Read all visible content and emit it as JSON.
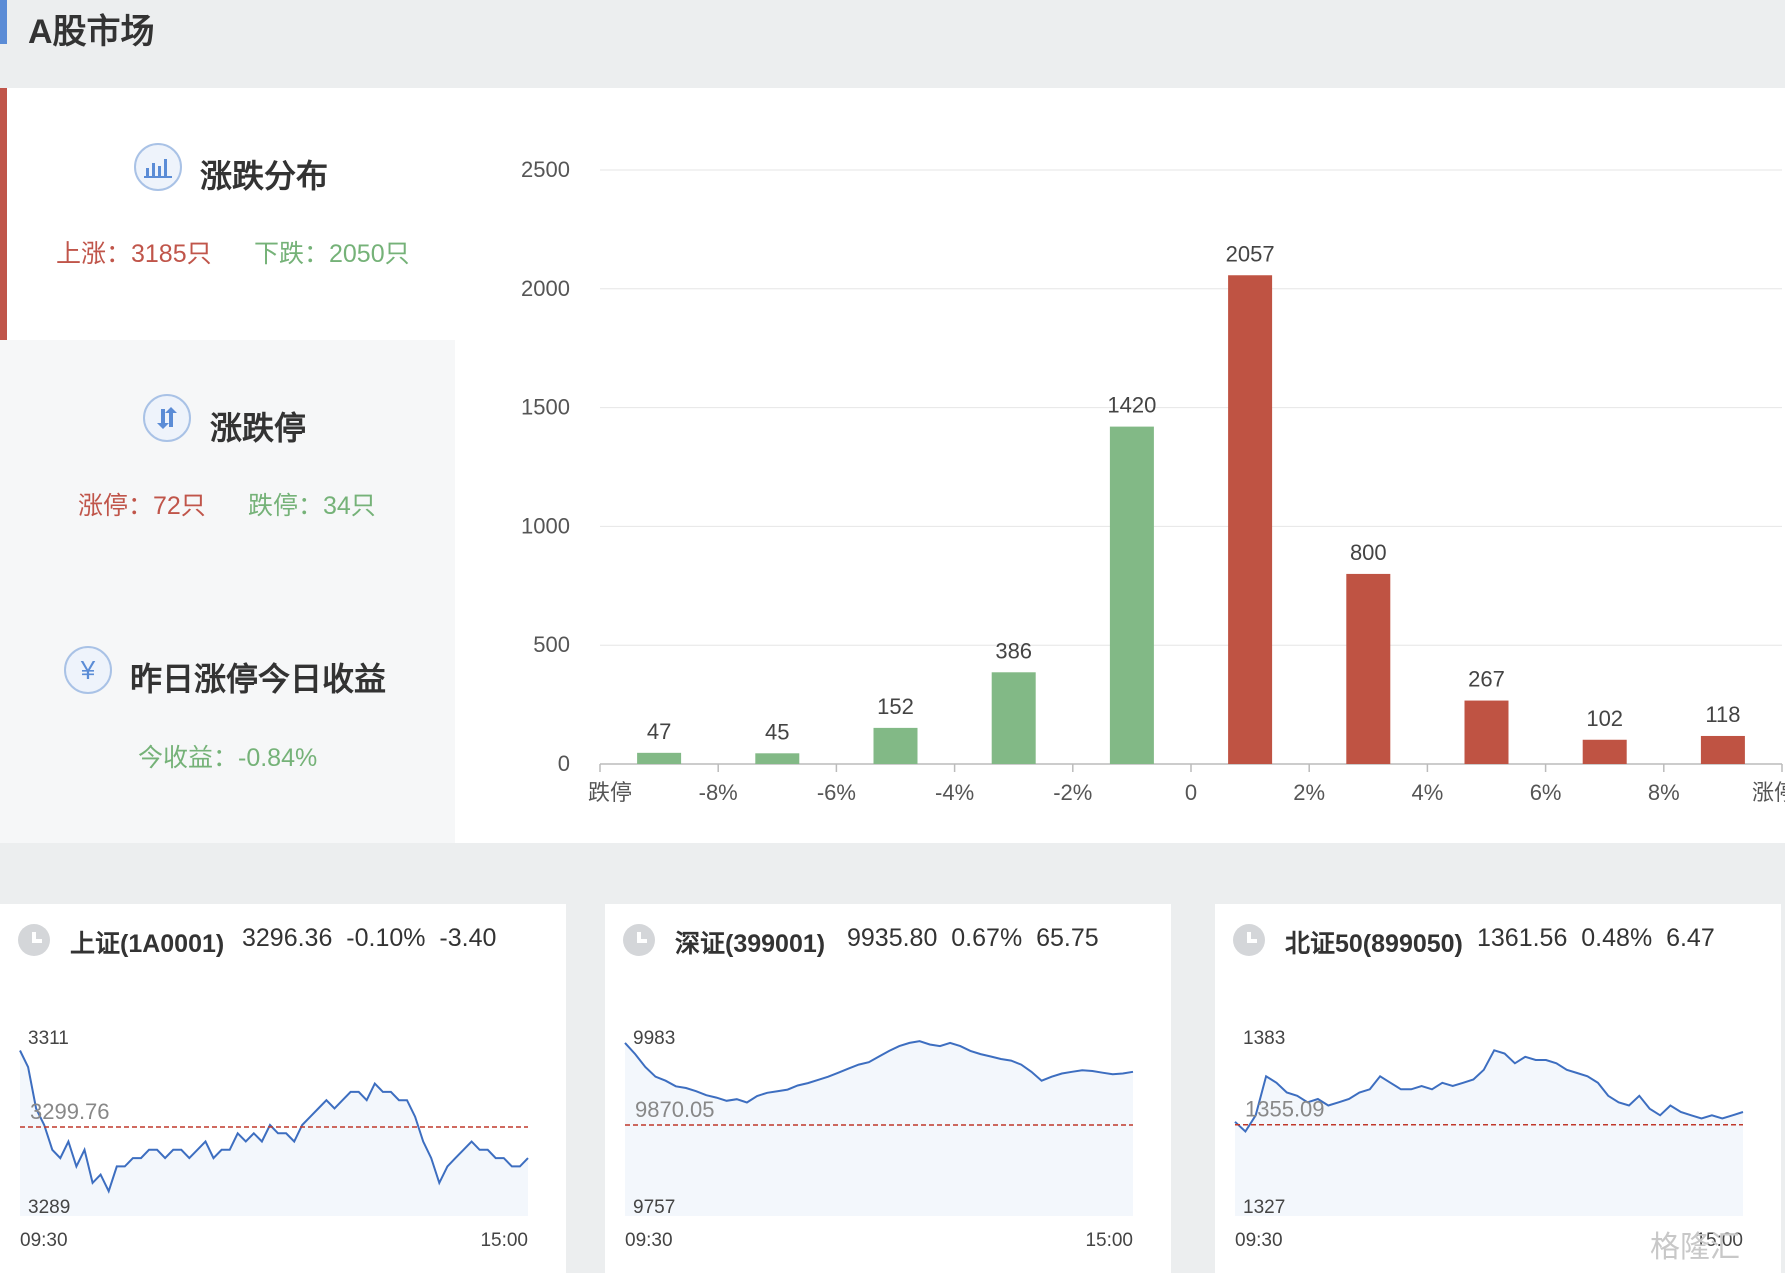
{
  "header": {
    "title": "A股市场"
  },
  "distribution": {
    "title": "涨跌分布",
    "up_label": "上涨：3185只",
    "down_label": "下跌：2050只"
  },
  "limits": {
    "title": "涨跌停",
    "up_label": "涨停：72只",
    "down_label": "跌停：34只"
  },
  "yesterday": {
    "title": "昨日涨停今日收益",
    "return_label": "今收益：-0.84%",
    "icon_glyph": "¥"
  },
  "chart_data": {
    "type": "bar",
    "categories": [
      "跌停",
      "-8%",
      "-6%",
      "-4%",
      "-2%",
      "0",
      "2%",
      "4%",
      "6%",
      "8%",
      "涨停"
    ],
    "bars": [
      {
        "value": 47,
        "color": "#82b986"
      },
      {
        "value": 45,
        "color": "#82b986"
      },
      {
        "value": 152,
        "color": "#82b986"
      },
      {
        "value": 386,
        "color": "#82b986"
      },
      {
        "value": 1420,
        "color": "#82b986"
      },
      {
        "value": 2057,
        "color": "#bf5343"
      },
      {
        "value": 800,
        "color": "#bf5343"
      },
      {
        "value": 267,
        "color": "#bf5343"
      },
      {
        "value": 102,
        "color": "#bf5343"
      },
      {
        "value": 118,
        "color": "#bf5343"
      }
    ],
    "ylim": [
      0,
      2500
    ],
    "yticks": [
      0,
      500,
      1000,
      1500,
      2000,
      2500
    ],
    "grid": true
  },
  "indices": [
    {
      "name": "上证(1A0001)",
      "value": "3296.36",
      "pct": "-0.10%",
      "change": "-3.40",
      "y_max_label": "3311",
      "y_ref_label": "3299.76",
      "y_min_label": "3289",
      "x_start_label": "09:30",
      "x_end_label": "15:00",
      "y_max": 3311,
      "y_min": 3289,
      "y_ref": 3299.76,
      "series": [
        3309,
        3307,
        3302,
        3300,
        3297,
        3296,
        3298,
        3295,
        3297,
        3293,
        3294,
        3292,
        3295,
        3295,
        3296,
        3296,
        3297,
        3297,
        3296,
        3297,
        3297,
        3296,
        3297,
        3298,
        3296,
        3297,
        3297,
        3299,
        3298,
        3299,
        3298,
        3300,
        3299,
        3299,
        3298,
        3300,
        3301,
        3302,
        3303,
        3302,
        3303,
        3304,
        3304,
        3303,
        3305,
        3304,
        3304,
        3303,
        3303,
        3301,
        3298,
        3296,
        3293,
        3295,
        3296,
        3297,
        3298,
        3297,
        3297,
        3296,
        3296,
        3295,
        3295,
        3296
      ]
    },
    {
      "name": "深证(399001)",
      "value": "9935.80",
      "pct": "0.67%",
      "change": "65.75",
      "y_max_label": "9983",
      "y_ref_label": "9870.05",
      "y_min_label": "9757",
      "x_start_label": "09:30",
      "x_end_label": "15:00",
      "y_max": 9983,
      "y_min": 9757,
      "y_ref": 9870.05,
      "series": [
        9972,
        9958,
        9942,
        9930,
        9925,
        9918,
        9916,
        9912,
        9907,
        9904,
        9900,
        9902,
        9898,
        9906,
        9910,
        9912,
        9914,
        9919,
        9922,
        9926,
        9930,
        9935,
        9940,
        9945,
        9948,
        9955,
        9962,
        9968,
        9972,
        9974,
        9970,
        9968,
        9972,
        9968,
        9962,
        9958,
        9955,
        9952,
        9950,
        9945,
        9936,
        9925,
        9930,
        9934,
        9936,
        9938,
        9937,
        9935,
        9933,
        9934,
        9936
      ]
    },
    {
      "name": "北证50(899050)",
      "value": "1361.56",
      "pct": "0.48%",
      "change": "6.47",
      "y_max_label": "1383",
      "y_ref_label": "1355.09",
      "y_min_label": "1327",
      "x_start_label": "09:30",
      "x_end_label": "15:00",
      "y_max": 1383,
      "y_min": 1327,
      "y_ref": 1355.09,
      "series": [
        1356,
        1353,
        1358,
        1370,
        1368,
        1365,
        1364,
        1362,
        1363,
        1361,
        1362,
        1363,
        1365,
        1366,
        1370,
        1368,
        1366,
        1366,
        1367,
        1366,
        1368,
        1367,
        1368,
        1369,
        1372,
        1378,
        1377,
        1374,
        1376,
        1375,
        1375,
        1374,
        1372,
        1371,
        1370,
        1368,
        1364,
        1362,
        1361,
        1364,
        1360,
        1358,
        1361,
        1359,
        1358,
        1357,
        1358,
        1357,
        1358,
        1359
      ]
    }
  ],
  "watermark": "格隆汇"
}
